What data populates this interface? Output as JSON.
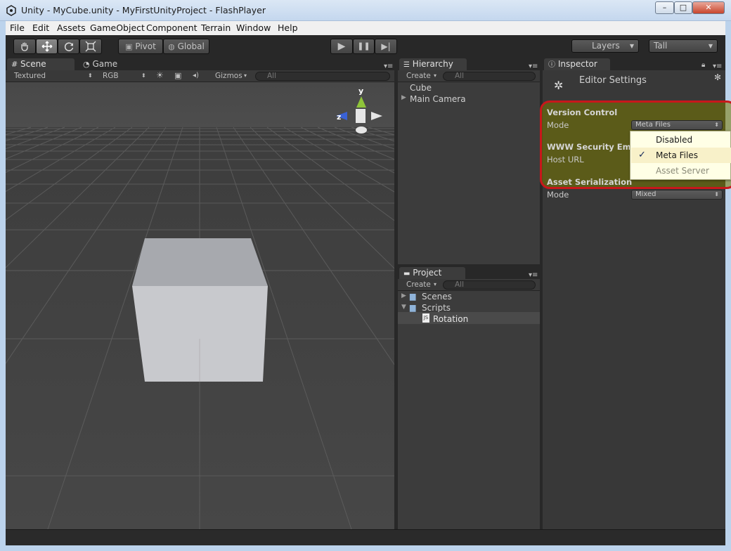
{
  "window": {
    "title": "Unity - MyCube.unity - MyFirstUnityProject - FlashPlayer",
    "minimize": "–",
    "maximize": "□",
    "close": "✕"
  },
  "menu": [
    "File",
    "Edit",
    "Assets",
    "GameObject",
    "Component",
    "Terrain",
    "Window",
    "Help"
  ],
  "toolbar": {
    "tools": [
      "hand-icon",
      "move-icon",
      "rotate-icon",
      "scale-icon"
    ],
    "pivot": "Pivot",
    "global": "Global",
    "play": "▶",
    "pause": "❚❚",
    "step": "▶|",
    "layers": "Layers",
    "layout": "Tall"
  },
  "scene": {
    "tab_scene": "Scene",
    "tab_game": "Game",
    "textured": "Textured",
    "rgb": "RGB",
    "gizmos": "Gizmos",
    "search_placeholder": "All",
    "axis_y": "y",
    "axis_z": "z"
  },
  "hierarchy": {
    "tab": "Hierarchy",
    "create": "Create",
    "search_placeholder": "All",
    "items": [
      "Cube",
      "Main Camera"
    ]
  },
  "project": {
    "tab": "Project",
    "create": "Create",
    "search_placeholder": "All",
    "items": [
      "Scenes",
      "Scripts",
      "Rotation"
    ]
  },
  "inspector": {
    "tab": "Inspector",
    "heading": "Editor Settings",
    "version_control": "Version Control",
    "mode_label": "Mode",
    "mode_value": "Meta Files",
    "www_security": "WWW Security Em",
    "host_url": "Host URL",
    "asset_serialization": "Asset Serialization",
    "mode2_label": "Mode",
    "mode2_value": "Mixed"
  },
  "popup": {
    "options": [
      "Disabled",
      "Meta Files",
      "Asset Server"
    ],
    "selected": "Meta Files",
    "check": "✓"
  },
  "colors": {
    "highlight_border": "#c8171b",
    "popup_bg": "#ffffe6",
    "editor_bg": "#282828"
  }
}
